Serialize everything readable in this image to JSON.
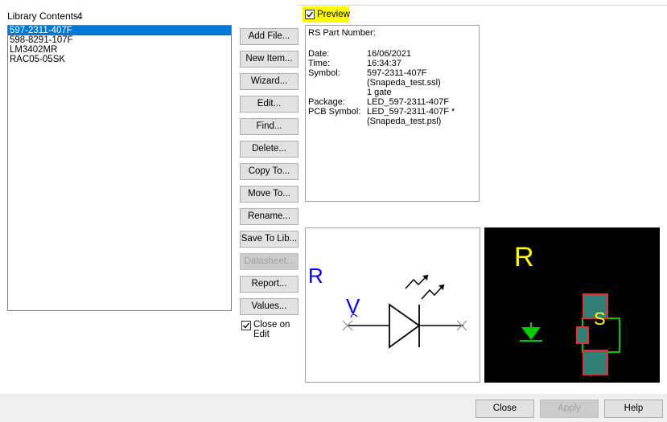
{
  "library": {
    "label": "Library Contents:",
    "count": "4",
    "items": [
      "597-2311-407F",
      "598-8291-107F",
      "LM3402MR",
      "RAC05-05SK"
    ],
    "selected_index": 0
  },
  "buttons": {
    "add_file": "Add File...",
    "new_item": "New Item...",
    "wizard": "Wizard...",
    "edit": "Edit...",
    "find": "Find...",
    "delete": "Delete...",
    "copy_to": "Copy To...",
    "move_to": "Move To...",
    "rename": "Rename...",
    "save_to_lib": "Save To Lib...",
    "datasheet": "Datasheet...",
    "report": "Report...",
    "values": "Values..."
  },
  "close_on_edit": {
    "label_line1": "Close on",
    "label_line2": "Edit",
    "checked": true
  },
  "preview": {
    "label": "Preview",
    "checked": true,
    "highlight_color": "#ffff00"
  },
  "info": {
    "rs_part_number_label": "RS Part Number:",
    "date_label": "Date:",
    "date_value": "16/06/2021",
    "time_label": "Time:",
    "time_value": "16:34:37",
    "symbol_label": "Symbol:",
    "symbol_value": "597-2311-407F",
    "symbol_file": "(Snapeda_test.ssl)",
    "symbol_gates": "1 gate",
    "package_label": "Package:",
    "package_value": "LED_597-2311-407F",
    "pcb_symbol_label": "PCB Symbol:",
    "pcb_symbol_value": "LED_597-2311-407F *",
    "pcb_symbol_file": "(Snapeda_test.psl)"
  },
  "symbol_preview": {
    "ref_label": "R",
    "value_label": "V",
    "color_ref": "#0000ff"
  },
  "pcb_preview": {
    "ref_label": "R",
    "silk_label": "S",
    "color_text": "#ffff00",
    "color_green": "#00cc00",
    "color_pad": "#e03030"
  },
  "footer": {
    "close": "Close",
    "apply": "Apply",
    "help": "Help"
  }
}
